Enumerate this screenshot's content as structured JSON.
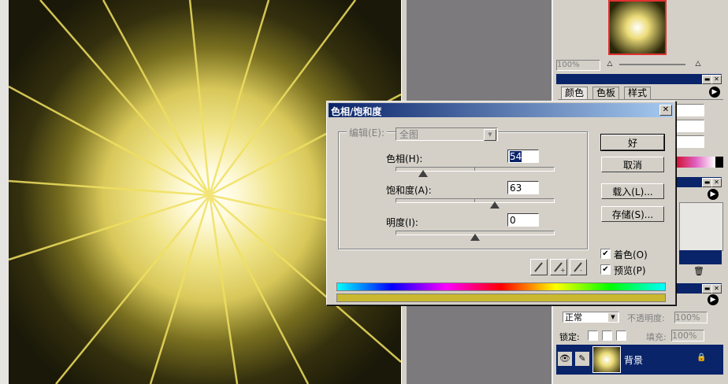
{
  "canvas": {
    "glow_color": "#f2e27a",
    "ray_color": "#e8d640",
    "background_color": "#1a1808"
  },
  "navigator": {
    "zoom_value": "100%"
  },
  "color_panel": {
    "tabs": [
      "颜色",
      "色板",
      "样式"
    ]
  },
  "layers_panel": {
    "blend_mode": "正常",
    "opacity_label": "不透明度:",
    "opacity_value": "100%",
    "lock_label": "锁定:",
    "fill_label": "填充:",
    "fill_value": "100%",
    "layer_name": "背景"
  },
  "dialog": {
    "title": "色相/饱和度",
    "edit_label": "编辑(E):",
    "edit_value": "全图",
    "hue_label": "色相(H):",
    "hue_value": "54",
    "saturation_label": "饱和度(A):",
    "saturation_value": "63",
    "lightness_label": "明度(I):",
    "lightness_value": "0",
    "ok_label": "好",
    "cancel_label": "取消",
    "load_label": "载入(L)...",
    "save_label": "存储(S)...",
    "colorize_label": "着色(O)",
    "colorize_checked": true,
    "preview_label": "预览(P)",
    "preview_checked": true,
    "hue_slider_fraction": 0.15,
    "saturation_slider_fraction": 0.63,
    "lightness_slider_fraction": 0.5,
    "result_bar_color": "#c9b830"
  }
}
